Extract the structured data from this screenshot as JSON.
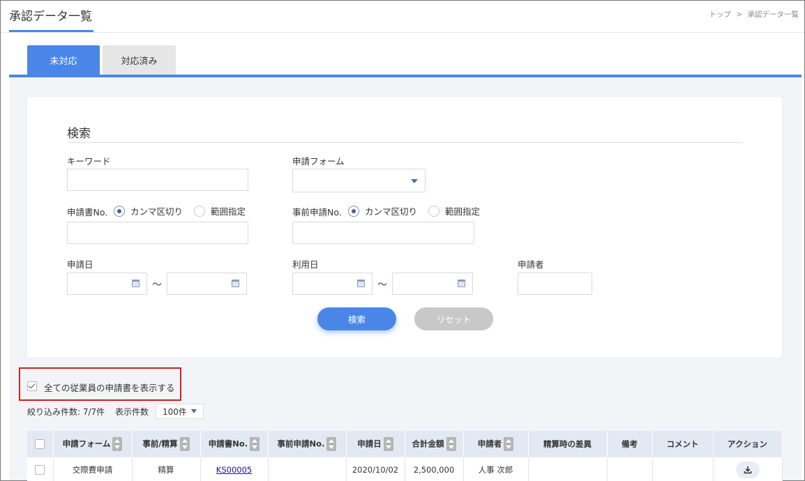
{
  "page": {
    "title": "承認データ一覧",
    "breadcrumb": [
      "トップ",
      ">",
      "承認データ一覧"
    ]
  },
  "tabs": [
    {
      "label": "未対応",
      "active": true
    },
    {
      "label": "対応済み",
      "active": false
    }
  ],
  "search": {
    "heading": "検索",
    "keyword_label": "キーワード",
    "keyword_value": "",
    "form_label": "申請フォーム",
    "form_value": "",
    "app_no_label": "申請書No.",
    "app_no_options": [
      "カンマ区切り",
      "範囲指定"
    ],
    "app_no_selected": "カンマ区切り",
    "pre_app_no_label": "事前申請No.",
    "pre_app_no_options": [
      "カンマ区切り",
      "範囲指定"
    ],
    "pre_app_no_selected": "カンマ区切り",
    "app_date_label": "申請日",
    "use_date_label": "利用日",
    "applicant_label": "申請者",
    "range_sep": "～",
    "search_button": "検索",
    "reset_button": "リセット"
  },
  "show_all": {
    "label": "全ての従業員の申請書を表示する",
    "checked": true
  },
  "list": {
    "filter_count": "絞り込み件数: 7/7件",
    "per_page_label": "表示件数",
    "per_page_value": "100件",
    "columns": [
      "申請フォーム",
      "事前/精算",
      "申請書No.",
      "事前申請No.",
      "申請日",
      "合計金額",
      "申請者",
      "精算時の差異",
      "備考",
      "コメント",
      "アクション"
    ],
    "rows": [
      {
        "form": "交際費申請",
        "type": "精算",
        "app_no": "KS00005",
        "pre_app_no": "",
        "date": "2020/10/02",
        "amount": "2,500,000",
        "applicant": "人事 次郎",
        "diff": "",
        "note": "",
        "comment": ""
      }
    ]
  },
  "colors": {
    "accent": "#4a86e8",
    "highlight_border": "#d21f1f",
    "header_bg": "#e3e9f2",
    "reset_button": "#c8c8c8"
  }
}
